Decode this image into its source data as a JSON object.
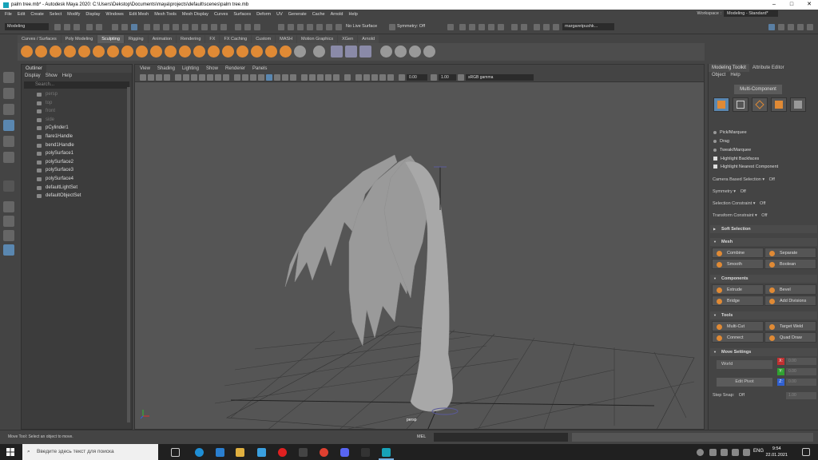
{
  "window": {
    "title": "palm tree.mb* - Autodesk Maya 2020: C:\\Users\\Dekstop\\Documents\\maya\\projects\\default\\scenes\\palm tree.mb"
  },
  "menu": [
    "File",
    "Edit",
    "Create",
    "Select",
    "Modify",
    "Display",
    "Windows",
    "Edit Mesh",
    "Mesh Tools",
    "Mesh Display",
    "Curves",
    "Surfaces",
    "Deform",
    "UV",
    "Generate",
    "Cache",
    "Arnold",
    "Help"
  ],
  "workspace": {
    "label": "Workspace :",
    "value": "Modeling - Standard*"
  },
  "statusline": {
    "mode": "Modeling",
    "live_surface": "No Live Surface",
    "symmetry": "Symmetry: Off",
    "user": "margaretpushk..."
  },
  "shelf_tabs": [
    "Curves / Surfaces",
    "Poly Modeling",
    "Sculpting",
    "Rigging",
    "Animation",
    "Rendering",
    "FX",
    "FX Caching",
    "Custom",
    "MASH",
    "Motion Graphics",
    "XGen",
    "Arnold"
  ],
  "shelf_active": "Sculpting",
  "outliner": {
    "title": "Outliner",
    "menus": [
      "Display",
      "Show",
      "Help"
    ],
    "search_placeholder": "Search...",
    "items": [
      {
        "label": "persp",
        "dim": true
      },
      {
        "label": "top",
        "dim": true
      },
      {
        "label": "front",
        "dim": true
      },
      {
        "label": "side",
        "dim": true
      },
      {
        "label": "pCylinder1",
        "dim": false
      },
      {
        "label": "flare1Handle",
        "dim": false
      },
      {
        "label": "bend1Handle",
        "dim": false
      },
      {
        "label": "polySurface1",
        "dim": false
      },
      {
        "label": "polySurface2",
        "dim": false
      },
      {
        "label": "polySurface3",
        "dim": false
      },
      {
        "label": "polySurface4",
        "dim": false
      },
      {
        "label": "defaultLightSet",
        "dim": false
      },
      {
        "label": "defaultObjectSet",
        "dim": false
      }
    ]
  },
  "viewport": {
    "menus": [
      "View",
      "Shading",
      "Lighting",
      "Show",
      "Renderer",
      "Panels"
    ],
    "exposure": "0.00",
    "gamma": "1.00",
    "colorspace": "sRGB gamma",
    "camera": "persp"
  },
  "toolkit": {
    "tabs": [
      "Modeling Toolkit",
      "Attribute Editor"
    ],
    "menus": [
      "Object",
      "Help"
    ],
    "multi_component": "Multi-Component",
    "pick_options": [
      "Pick/Marquee",
      "Drag",
      "Tweak/Marquee"
    ],
    "checks": [
      "Highlight Backfaces",
      "Highlight Nearest Component"
    ],
    "camera_based": "Camera Based Selection ▾",
    "camera_based_value": "Off",
    "symmetry": "Symmetry ▾",
    "symmetry_value": "Off",
    "selection_constraint": "Selection Constraint ▾",
    "selection_constraint_value": "Off",
    "transform_constraint": "Transform Constraint ▾",
    "transform_constraint_value": "Off",
    "soft_selection": "Soft Selection",
    "mesh_section": "Mesh",
    "mesh_buttons": [
      "Combine",
      "Separate",
      "Smooth",
      "Boolean"
    ],
    "components_section": "Components",
    "components_buttons": [
      "Extrude",
      "Bevel",
      "Bridge",
      "Add Divisions"
    ],
    "tools_section": "Tools",
    "tools_buttons": [
      "Multi-Cut",
      "Target Weld",
      "Connect",
      "Quad Draw"
    ],
    "move_section": "Move Settings",
    "world": "World",
    "edit_pivot": "Edit Pivot",
    "x_label": "X:",
    "y_label": "Y:",
    "z_label": "Z:",
    "x_val": "0.00",
    "y_val": "0.00",
    "z_val": "0.00",
    "step_snap": "Step Snap:",
    "step_snap_value": "Off",
    "step_val": "1.00"
  },
  "helpline": {
    "text": "Move Tool: Select an object to move.",
    "mel": "MEL"
  },
  "taskbar": {
    "search": "Введите здесь текст для поиска",
    "lang": "ENG",
    "time": "9:54",
    "date": "22.01.2021"
  },
  "colors": {
    "accent": "#5a87b0",
    "orange": "#e08a35"
  }
}
